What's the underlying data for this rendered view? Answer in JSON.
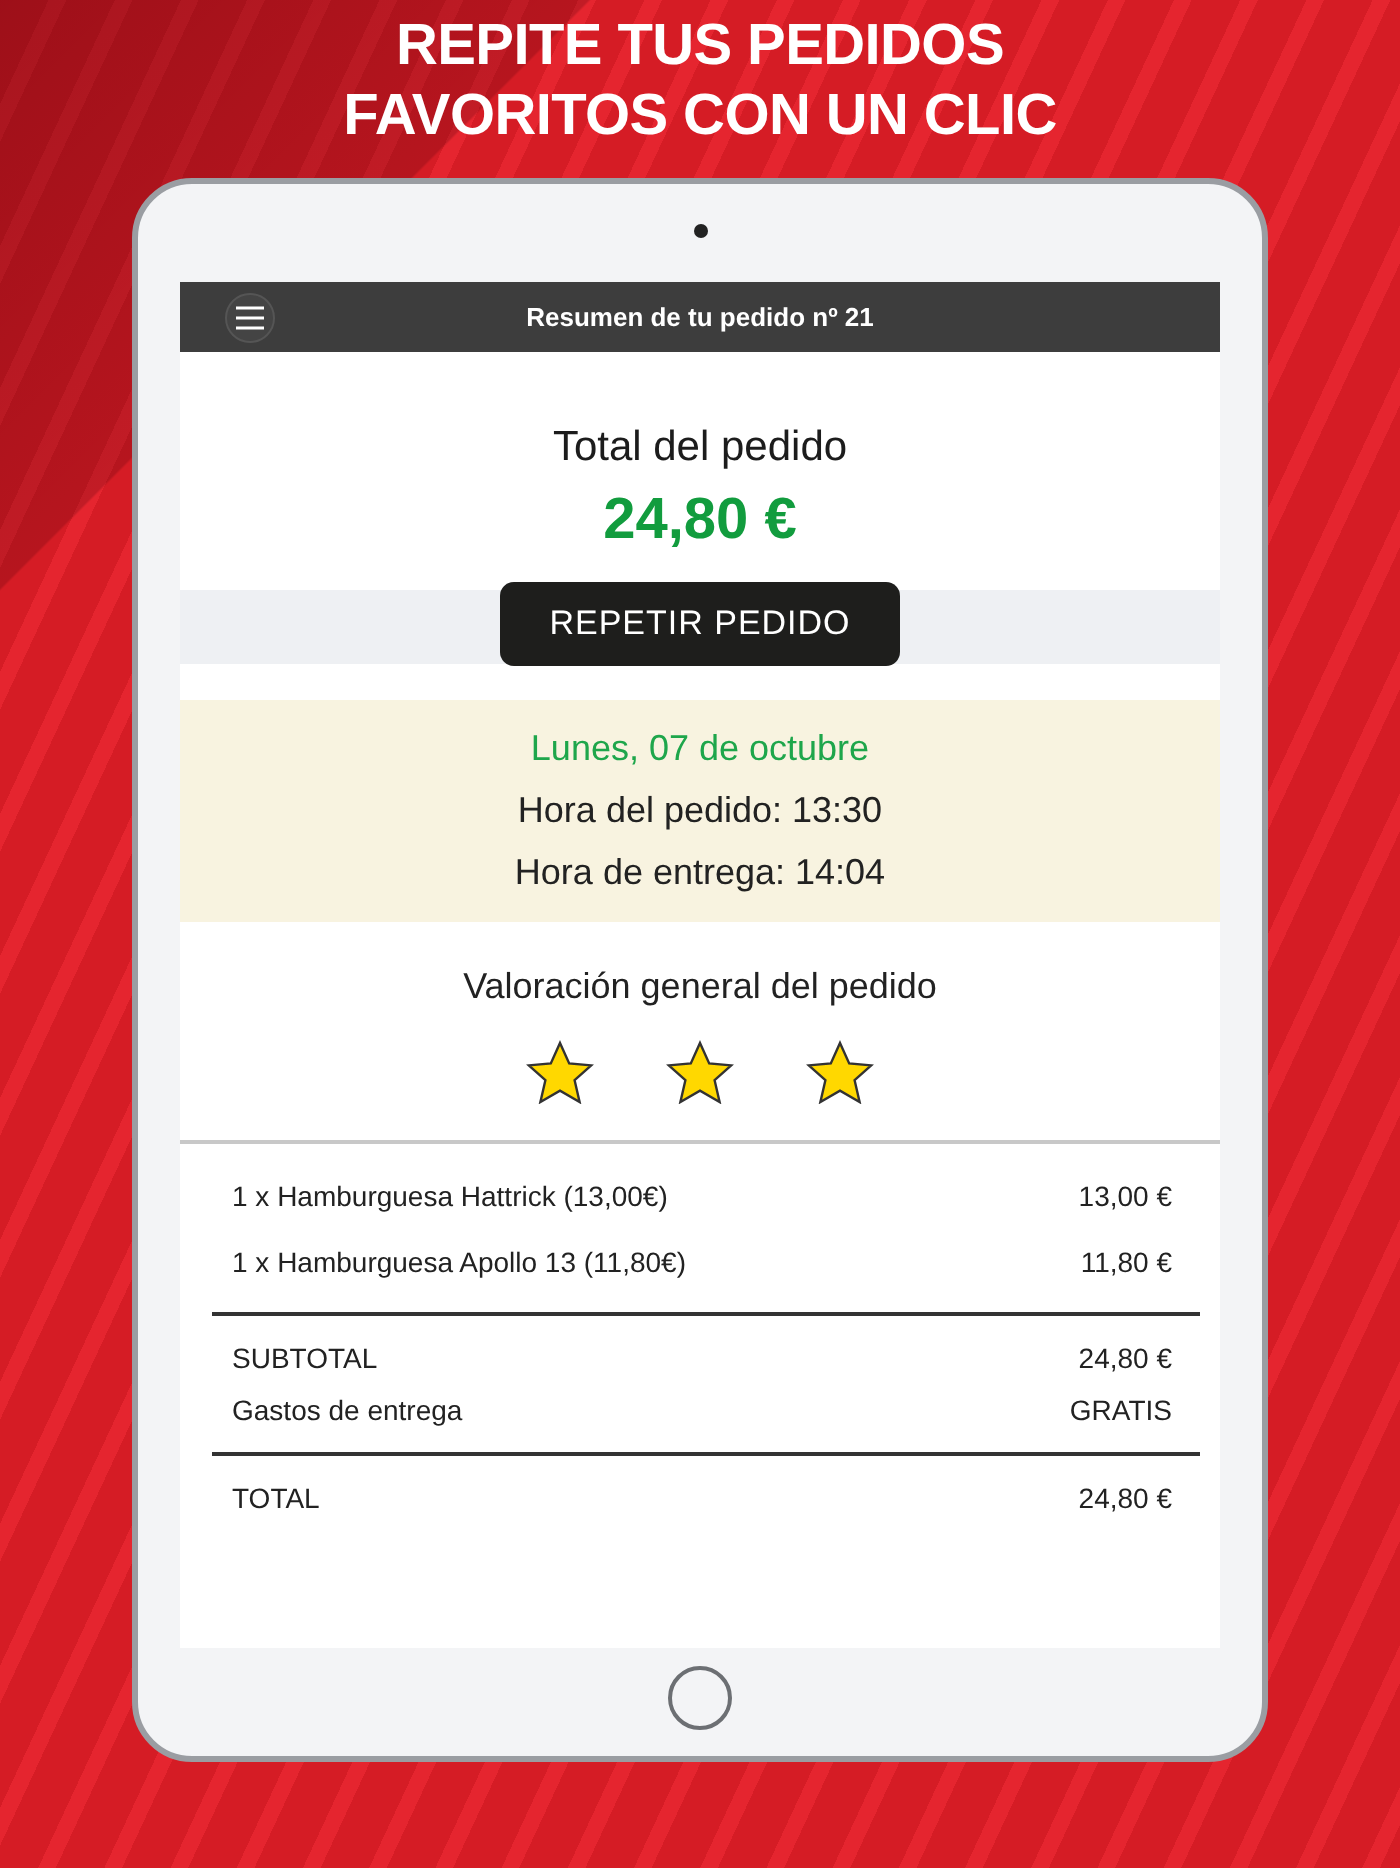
{
  "headline": [
    "REPITE TUS PEDIDOS",
    "FAVORITOS CON UN CLIC"
  ],
  "header": {
    "title": "Resumen de tu pedido nº 21"
  },
  "summary": {
    "label": "Total del pedido",
    "amount": "24,80 €"
  },
  "repeat_button": "REPETIR PEDIDO",
  "schedule": {
    "date": "Lunes, 07 de octubre",
    "order_time": "Hora del pedido: 13:30",
    "delivery_time": "Hora de entrega: 14:04"
  },
  "rating": {
    "label": "Valoración general del pedido",
    "stars": 3
  },
  "items": [
    {
      "name": "1 x Hamburguesa Hattrick (13,00€)",
      "price": "13,00 €"
    },
    {
      "name": "1 x Hamburguesa Apollo 13 (11,80€)",
      "price": "11,80 €"
    }
  ],
  "totals": [
    {
      "label": "SUBTOTAL",
      "value": "24,80 €"
    },
    {
      "label": "Gastos de entrega",
      "value": "GRATIS"
    }
  ],
  "total": {
    "label": "TOTAL",
    "value": "24,80 €"
  }
}
